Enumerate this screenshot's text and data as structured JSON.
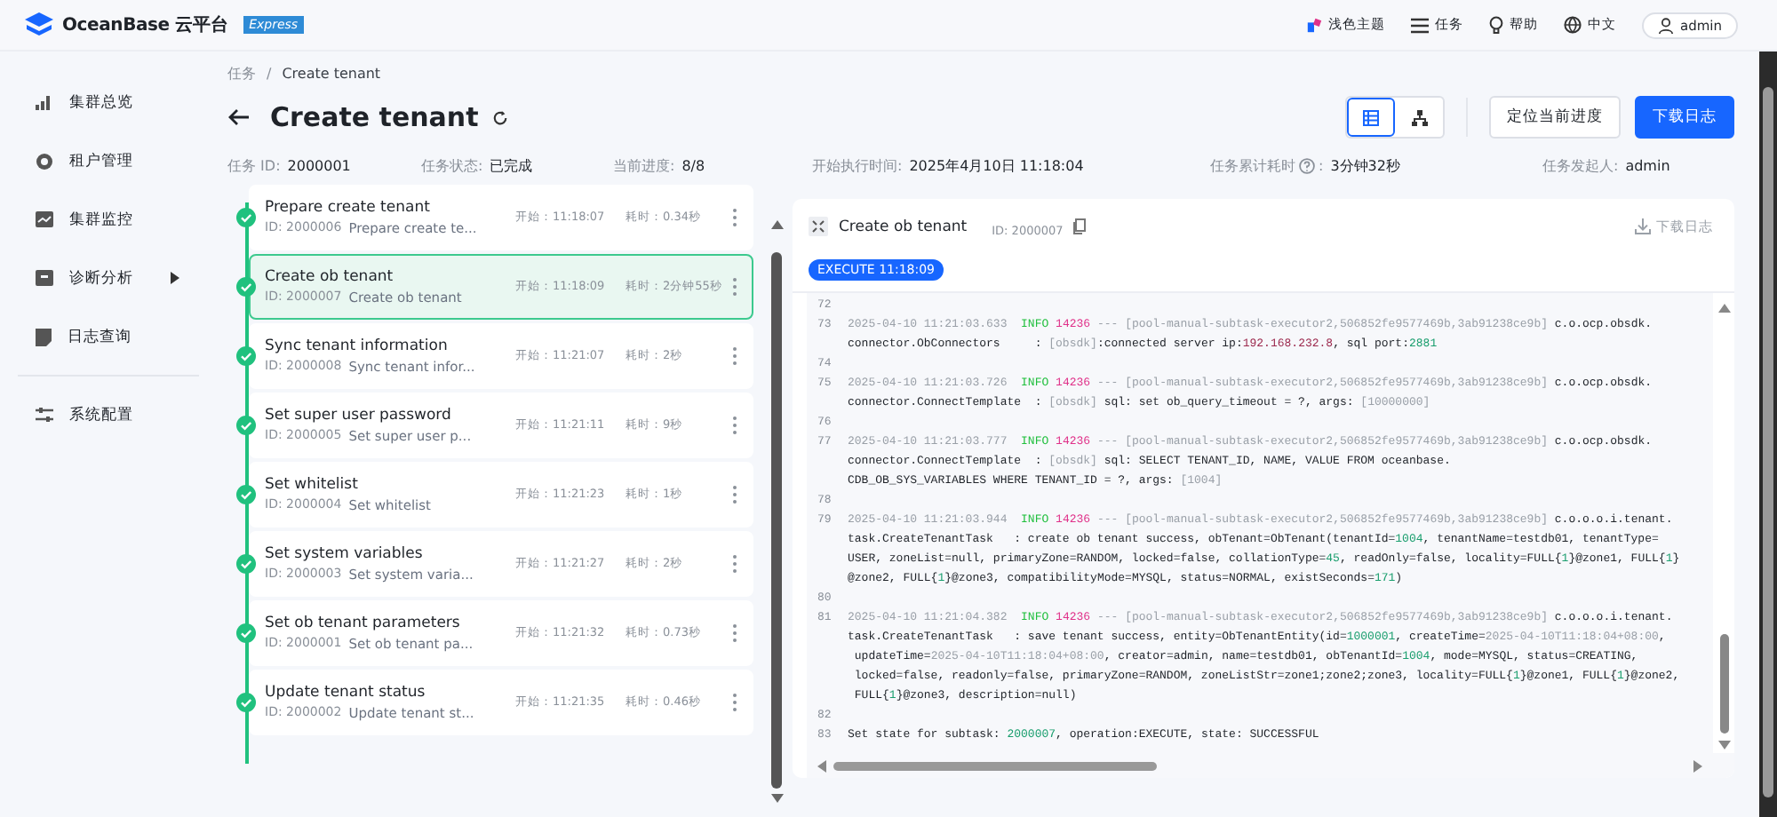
{
  "header": {
    "brand": "OceanBase 云平台",
    "edition": "Express",
    "items": [
      {
        "kind": "theme",
        "label": "浅色主题"
      },
      {
        "kind": "tasks",
        "label": "任务"
      },
      {
        "kind": "help",
        "label": "帮助"
      },
      {
        "kind": "language",
        "label": "中文"
      }
    ],
    "user": "admin"
  },
  "sidebar": {
    "items": [
      {
        "kind": "chart",
        "label": "集群总览",
        "expandable": false
      },
      {
        "kind": "tenant",
        "label": "租户管理",
        "expandable": false
      },
      {
        "kind": "monitor",
        "label": "集群监控",
        "expandable": false
      },
      {
        "kind": "diagnose",
        "label": "诊断分析",
        "expandable": true
      },
      {
        "kind": "log",
        "label": "日志查询",
        "expandable": false
      }
    ],
    "footer_items": [
      {
        "kind": "settings",
        "label": "系统配置"
      }
    ]
  },
  "breadcrumb": {
    "separator": "/",
    "items": [
      "任务",
      "Create tenant"
    ]
  },
  "title": "Create tenant",
  "view_toggles": [
    {
      "kind": "list",
      "selected": true
    },
    {
      "kind": "tree",
      "selected": false
    }
  ],
  "actions": [
    {
      "label": "定位当前进度",
      "primary": false
    },
    {
      "label": "下载日志",
      "primary": true
    }
  ],
  "info": [
    {
      "label": "任务 ID:",
      "value": "2000001",
      "help": false
    },
    {
      "label": "任务状态:",
      "value": "已完成",
      "help": false
    },
    {
      "label": "当前进度:",
      "value": "8/8",
      "help": false
    },
    {
      "label": "开始执行时间:",
      "value": "2025年4月10日 11:18:04",
      "help": false
    },
    {
      "label": "任务累计耗时",
      "after": ":",
      "value": "3分钟32秒",
      "help": true
    },
    {
      "label": "任务发起人:",
      "value": "admin",
      "help": false
    }
  ],
  "tasks": [
    {
      "name": "Prepare create tenant",
      "id": "ID: 2000006",
      "desc": "Prepare create te...",
      "start": "开始：11:18:07",
      "duration": "耗时：0.34秒",
      "selected": false
    },
    {
      "name": "Create ob tenant",
      "id": "ID: 2000007",
      "desc": "Create ob tenant",
      "start": "开始：11:18:09",
      "duration": "耗时：2分钟55秒",
      "selected": true
    },
    {
      "name": "Sync tenant information",
      "id": "ID: 2000008",
      "desc": "Sync tenant infor...",
      "start": "开始：11:21:07",
      "duration": "耗时：2秒",
      "selected": false
    },
    {
      "name": "Set super user password",
      "id": "ID: 2000005",
      "desc": "Set super user p...",
      "start": "开始：11:21:11",
      "duration": "耗时：9秒",
      "selected": false
    },
    {
      "name": "Set whitelist",
      "id": "ID: 2000004",
      "desc": "Set whitelist",
      "start": "开始：11:21:23",
      "duration": "耗时：1秒",
      "selected": false
    },
    {
      "name": "Set system variables",
      "id": "ID: 2000003",
      "desc": "Set system varia...",
      "start": "开始：11:21:27",
      "duration": "耗时：2秒",
      "selected": false
    },
    {
      "name": "Set ob tenant parameters",
      "id": "ID: 2000001",
      "desc": "Set ob tenant pa...",
      "start": "开始：11:21:32",
      "duration": "耗时：0.73秒",
      "selected": false
    },
    {
      "name": "Update tenant status",
      "id": "ID: 2000002",
      "desc": "Update tenant st...",
      "start": "开始：11:21:35",
      "duration": "耗时：0.46秒",
      "selected": false
    }
  ],
  "detail": {
    "title": "Create ob tenant",
    "id": "ID: 2000007",
    "download": "下载日志",
    "tag": "EXECUTE 11:18:09",
    "log": [
      {
        "no": "72"
      },
      {
        "no": "73",
        "lines": [
          [
            {
              "kind": "muted",
              "text": "2025-04-10 11:21:03.633  "
            },
            {
              "kind": "info",
              "text": "INFO "
            },
            {
              "kind": "pid",
              "text": "14236"
            },
            {
              "kind": "muted",
              "text": " --- [pool-manual-subtask-executor2,506852fe9577469b,3ab91238ce9b] "
            },
            {
              "kind": "text",
              "text": "c.o.ocp.obsdk."
            }
          ],
          [
            {
              "kind": "text",
              "text": "connector.ObConnectors     : "
            },
            {
              "kind": "muted",
              "text": "[obsdk]"
            },
            {
              "kind": "text",
              "text": ":connected server ip:"
            },
            {
              "kind": "string",
              "text": "192.168.232.8"
            },
            {
              "kind": "text",
              "text": ", sql port:"
            },
            {
              "kind": "number",
              "text": "2881"
            }
          ]
        ]
      },
      {
        "no": "74"
      },
      {
        "no": "75",
        "lines": [
          [
            {
              "kind": "muted",
              "text": "2025-04-10 11:21:03.726  "
            },
            {
              "kind": "info",
              "text": "INFO "
            },
            {
              "kind": "pid",
              "text": "14236"
            },
            {
              "kind": "muted",
              "text": " --- [pool-manual-subtask-executor2,506852fe9577469b,3ab91238ce9b] "
            },
            {
              "kind": "text",
              "text": "c.o.ocp.obsdk."
            }
          ],
          [
            {
              "kind": "text",
              "text": "connector.ConnectTemplate  : "
            },
            {
              "kind": "muted",
              "text": "[obsdk]"
            },
            {
              "kind": "text",
              "text": " sql: set ob_query_timeout = ?, args: "
            },
            {
              "kind": "muted",
              "text": "[10000000]"
            }
          ]
        ]
      },
      {
        "no": "76"
      },
      {
        "no": "77",
        "lines": [
          [
            {
              "kind": "muted",
              "text": "2025-04-10 11:21:03.777  "
            },
            {
              "kind": "info",
              "text": "INFO "
            },
            {
              "kind": "pid",
              "text": "14236"
            },
            {
              "kind": "muted",
              "text": " --- [pool-manual-subtask-executor2,506852fe9577469b,3ab91238ce9b] "
            },
            {
              "kind": "text",
              "text": "c.o.ocp.obsdk."
            }
          ],
          [
            {
              "kind": "text",
              "text": "connector.ConnectTemplate  : "
            },
            {
              "kind": "muted",
              "text": "[obsdk]"
            },
            {
              "kind": "text",
              "text": " sql: SELECT TENANT_ID, NAME, VALUE FROM oceanbase."
            }
          ],
          [
            {
              "kind": "text",
              "text": "CDB_OB_SYS_VARIABLES WHERE TENANT_ID = ?, args: "
            },
            {
              "kind": "muted",
              "text": "[1004]"
            }
          ]
        ]
      },
      {
        "no": "78"
      },
      {
        "no": "79",
        "lines": [
          [
            {
              "kind": "muted",
              "text": "2025-04-10 11:21:03.944  "
            },
            {
              "kind": "info",
              "text": "INFO "
            },
            {
              "kind": "pid",
              "text": "14236"
            },
            {
              "kind": "muted",
              "text": " --- [pool-manual-subtask-executor2,506852fe9577469b,3ab91238ce9b] "
            },
            {
              "kind": "text",
              "text": "c.o.o.o.i.tenant."
            }
          ],
          [
            {
              "kind": "text",
              "text": "task.CreateTenantTask   : create ob tenant success, obTenant=ObTenant(tenantId="
            },
            {
              "kind": "number",
              "text": "1004"
            },
            {
              "kind": "text",
              "text": ", tenantName=testdb01, tenantType="
            }
          ],
          [
            {
              "kind": "text",
              "text": "USER, zoneList=null, primaryZone=RANDOM, locked=false, collationType="
            },
            {
              "kind": "number",
              "text": "45"
            },
            {
              "kind": "text",
              "text": ", readOnly=false, locality=FULL{"
            },
            {
              "kind": "number",
              "text": "1"
            },
            {
              "kind": "text",
              "text": "}@zone1, FULL{"
            },
            {
              "kind": "number",
              "text": "1"
            },
            {
              "kind": "text",
              "text": "}"
            }
          ],
          [
            {
              "kind": "text",
              "text": "@zone2, FULL{"
            },
            {
              "kind": "number",
              "text": "1"
            },
            {
              "kind": "text",
              "text": "}@zone3, compatibilityMode=MYSQL, status=NORMAL, existSeconds="
            },
            {
              "kind": "number",
              "text": "171"
            },
            {
              "kind": "text",
              "text": ")"
            }
          ]
        ]
      },
      {
        "no": "80"
      },
      {
        "no": "81",
        "lines": [
          [
            {
              "kind": "muted",
              "text": "2025-04-10 11:21:04.382  "
            },
            {
              "kind": "info",
              "text": "INFO "
            },
            {
              "kind": "pid",
              "text": "14236"
            },
            {
              "kind": "muted",
              "text": " --- [pool-manual-subtask-executor2,506852fe9577469b,3ab91238ce9b] "
            },
            {
              "kind": "text",
              "text": "c.o.o.o.i.tenant."
            }
          ],
          [
            {
              "kind": "text",
              "text": "task.CreateTenantTask   : save tenant success, entity=ObTenantEntity(id="
            },
            {
              "kind": "number",
              "text": "1000001"
            },
            {
              "kind": "text",
              "text": ", createTime="
            },
            {
              "kind": "muted",
              "text": "2025-04-10T11:18:04+08:00"
            },
            {
              "kind": "text",
              "text": ","
            }
          ],
          [
            {
              "kind": "text",
              "text": " updateTime="
            },
            {
              "kind": "muted",
              "text": "2025-04-10T11:18:04+08:00"
            },
            {
              "kind": "text",
              "text": ", creator=admin, name=testdb01, obTenantId="
            },
            {
              "kind": "number",
              "text": "1004"
            },
            {
              "kind": "text",
              "text": ", mode=MYSQL, status=CREATING,"
            }
          ],
          [
            {
              "kind": "text",
              "text": " locked=false, readonly=false, primaryZone=RANDOM, zoneListStr=zone1;zone2;zone3, locality=FULL{"
            },
            {
              "kind": "number",
              "text": "1"
            },
            {
              "kind": "text",
              "text": "}@zone1, FULL{"
            },
            {
              "kind": "number",
              "text": "1"
            },
            {
              "kind": "text",
              "text": "}@zone2,"
            }
          ],
          [
            {
              "kind": "text",
              "text": " FULL{"
            },
            {
              "kind": "number",
              "text": "1"
            },
            {
              "kind": "text",
              "text": "}@zone3, description=null)"
            }
          ]
        ]
      },
      {
        "no": "82"
      },
      {
        "no": "83",
        "lines": [
          [
            {
              "kind": "text",
              "text": "Set state for subtask: "
            },
            {
              "kind": "number",
              "text": "2000007"
            },
            {
              "kind": "text",
              "text": ", operation:EXECUTE, state: SUCCESSFUL"
            }
          ]
        ]
      }
    ]
  }
}
